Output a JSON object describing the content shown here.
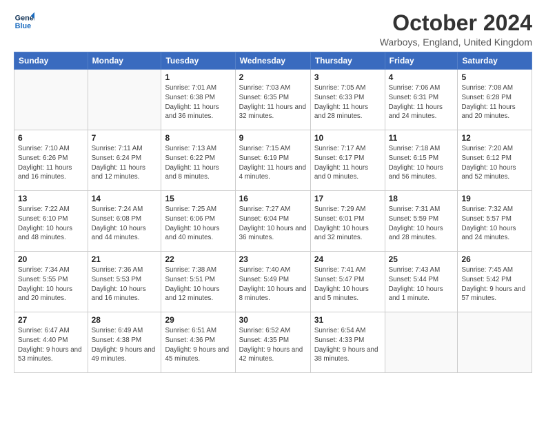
{
  "logo": {
    "line1": "General",
    "line2": "Blue"
  },
  "title": "October 2024",
  "location": "Warboys, England, United Kingdom",
  "days_of_week": [
    "Sunday",
    "Monday",
    "Tuesday",
    "Wednesday",
    "Thursday",
    "Friday",
    "Saturday"
  ],
  "weeks": [
    [
      {
        "day": "",
        "info": ""
      },
      {
        "day": "",
        "info": ""
      },
      {
        "day": "1",
        "info": "Sunrise: 7:01 AM\nSunset: 6:38 PM\nDaylight: 11 hours\nand 36 minutes."
      },
      {
        "day": "2",
        "info": "Sunrise: 7:03 AM\nSunset: 6:35 PM\nDaylight: 11 hours\nand 32 minutes."
      },
      {
        "day": "3",
        "info": "Sunrise: 7:05 AM\nSunset: 6:33 PM\nDaylight: 11 hours\nand 28 minutes."
      },
      {
        "day": "4",
        "info": "Sunrise: 7:06 AM\nSunset: 6:31 PM\nDaylight: 11 hours\nand 24 minutes."
      },
      {
        "day": "5",
        "info": "Sunrise: 7:08 AM\nSunset: 6:28 PM\nDaylight: 11 hours\nand 20 minutes."
      }
    ],
    [
      {
        "day": "6",
        "info": "Sunrise: 7:10 AM\nSunset: 6:26 PM\nDaylight: 11 hours\nand 16 minutes."
      },
      {
        "day": "7",
        "info": "Sunrise: 7:11 AM\nSunset: 6:24 PM\nDaylight: 11 hours\nand 12 minutes."
      },
      {
        "day": "8",
        "info": "Sunrise: 7:13 AM\nSunset: 6:22 PM\nDaylight: 11 hours\nand 8 minutes."
      },
      {
        "day": "9",
        "info": "Sunrise: 7:15 AM\nSunset: 6:19 PM\nDaylight: 11 hours\nand 4 minutes."
      },
      {
        "day": "10",
        "info": "Sunrise: 7:17 AM\nSunset: 6:17 PM\nDaylight: 11 hours\nand 0 minutes."
      },
      {
        "day": "11",
        "info": "Sunrise: 7:18 AM\nSunset: 6:15 PM\nDaylight: 10 hours\nand 56 minutes."
      },
      {
        "day": "12",
        "info": "Sunrise: 7:20 AM\nSunset: 6:12 PM\nDaylight: 10 hours\nand 52 minutes."
      }
    ],
    [
      {
        "day": "13",
        "info": "Sunrise: 7:22 AM\nSunset: 6:10 PM\nDaylight: 10 hours\nand 48 minutes."
      },
      {
        "day": "14",
        "info": "Sunrise: 7:24 AM\nSunset: 6:08 PM\nDaylight: 10 hours\nand 44 minutes."
      },
      {
        "day": "15",
        "info": "Sunrise: 7:25 AM\nSunset: 6:06 PM\nDaylight: 10 hours\nand 40 minutes."
      },
      {
        "day": "16",
        "info": "Sunrise: 7:27 AM\nSunset: 6:04 PM\nDaylight: 10 hours\nand 36 minutes."
      },
      {
        "day": "17",
        "info": "Sunrise: 7:29 AM\nSunset: 6:01 PM\nDaylight: 10 hours\nand 32 minutes."
      },
      {
        "day": "18",
        "info": "Sunrise: 7:31 AM\nSunset: 5:59 PM\nDaylight: 10 hours\nand 28 minutes."
      },
      {
        "day": "19",
        "info": "Sunrise: 7:32 AM\nSunset: 5:57 PM\nDaylight: 10 hours\nand 24 minutes."
      }
    ],
    [
      {
        "day": "20",
        "info": "Sunrise: 7:34 AM\nSunset: 5:55 PM\nDaylight: 10 hours\nand 20 minutes."
      },
      {
        "day": "21",
        "info": "Sunrise: 7:36 AM\nSunset: 5:53 PM\nDaylight: 10 hours\nand 16 minutes."
      },
      {
        "day": "22",
        "info": "Sunrise: 7:38 AM\nSunset: 5:51 PM\nDaylight: 10 hours\nand 12 minutes."
      },
      {
        "day": "23",
        "info": "Sunrise: 7:40 AM\nSunset: 5:49 PM\nDaylight: 10 hours\nand 8 minutes."
      },
      {
        "day": "24",
        "info": "Sunrise: 7:41 AM\nSunset: 5:47 PM\nDaylight: 10 hours\nand 5 minutes."
      },
      {
        "day": "25",
        "info": "Sunrise: 7:43 AM\nSunset: 5:44 PM\nDaylight: 10 hours\nand 1 minute."
      },
      {
        "day": "26",
        "info": "Sunrise: 7:45 AM\nSunset: 5:42 PM\nDaylight: 9 hours\nand 57 minutes."
      }
    ],
    [
      {
        "day": "27",
        "info": "Sunrise: 6:47 AM\nSunset: 4:40 PM\nDaylight: 9 hours\nand 53 minutes."
      },
      {
        "day": "28",
        "info": "Sunrise: 6:49 AM\nSunset: 4:38 PM\nDaylight: 9 hours\nand 49 minutes."
      },
      {
        "day": "29",
        "info": "Sunrise: 6:51 AM\nSunset: 4:36 PM\nDaylight: 9 hours\nand 45 minutes."
      },
      {
        "day": "30",
        "info": "Sunrise: 6:52 AM\nSunset: 4:35 PM\nDaylight: 9 hours\nand 42 minutes."
      },
      {
        "day": "31",
        "info": "Sunrise: 6:54 AM\nSunset: 4:33 PM\nDaylight: 9 hours\nand 38 minutes."
      },
      {
        "day": "",
        "info": ""
      },
      {
        "day": "",
        "info": ""
      }
    ]
  ]
}
